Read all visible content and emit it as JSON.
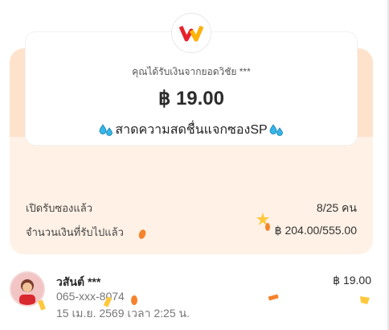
{
  "header": {
    "logo_icon": "wallet-logo-icon",
    "sender_text": "คุณได้รับเงินจากยอดวิชัย ***",
    "amount": "฿ 19.00",
    "message": "สาดความสดชื่นแจกซองSP",
    "message_icon": "water-drops-icon"
  },
  "stats": {
    "opened_label": "เปิดรับซองแล้ว",
    "opened_value": "8/25 คน",
    "received_label": "จำนวนเงินที่รับไปแล้ว",
    "received_value": "฿ 204.00/555.00"
  },
  "recipient": {
    "name": "วสันต์ ***",
    "phone": "065-xxx-8074",
    "time": "15 เม.ย. 2569 เวลา 2:25 น.",
    "amount": "฿ 19.00"
  },
  "colors": {
    "envelope": "#fff1e6",
    "envelope_flap": "#ffe2cc",
    "confetti_orange": "#f5832b",
    "confetti_yellow": "#ffc83d",
    "logo_red": "#e8202a",
    "logo_yellow": "#ffb400",
    "water_blue": "#35b6e8"
  }
}
